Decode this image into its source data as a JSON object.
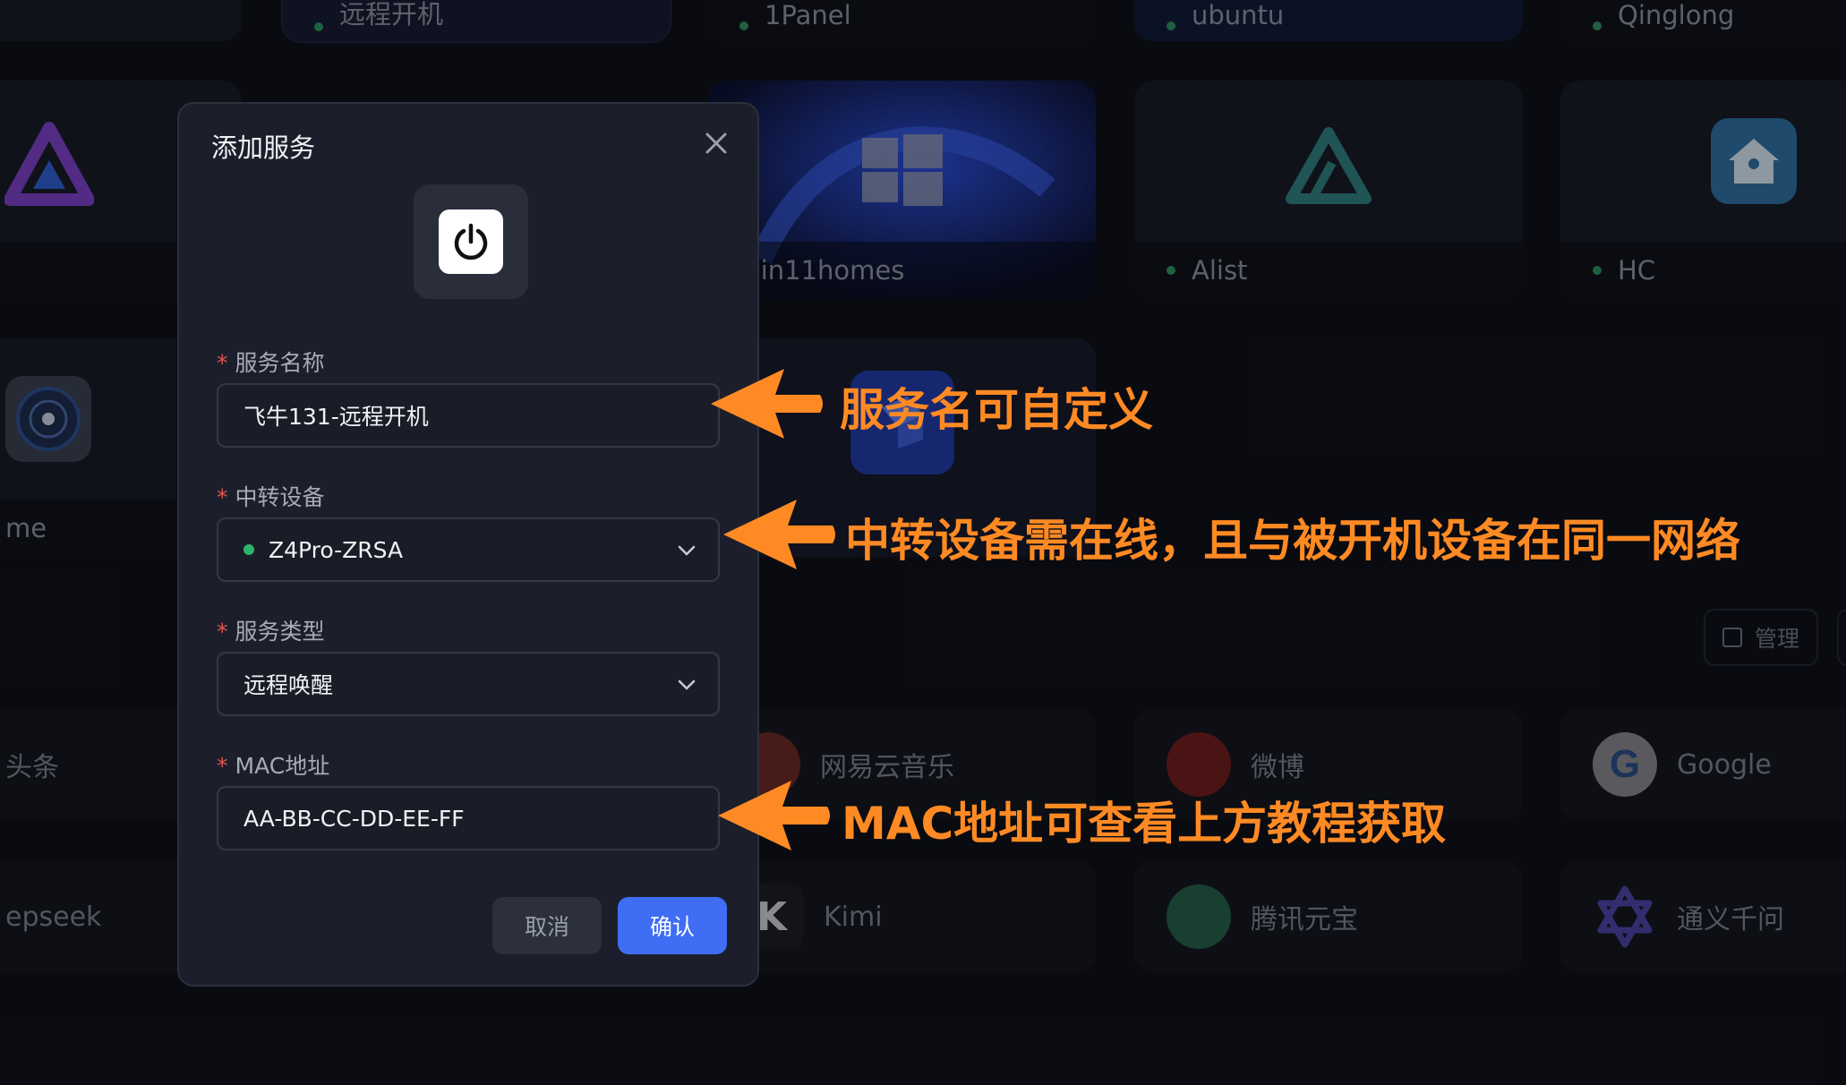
{
  "background": {
    "top_tiles": [
      {
        "label": ""
      },
      {
        "label": "远程开机"
      },
      {
        "label": "1Panel"
      },
      {
        "label": "ubuntu"
      },
      {
        "label": "Qinglong"
      }
    ],
    "apps_row1": [
      {
        "label": "",
        "icon": "jellyfin-icon"
      },
      {
        "label": "win11homes",
        "icon": "windows-icon"
      },
      {
        "label": "Alist",
        "icon": "alist-icon"
      },
      {
        "label": "HC",
        "icon": "home-assistant-icon"
      }
    ],
    "apps_row2": [
      {
        "label": "me",
        "icon": "music-disc-icon"
      },
      {
        "label": "",
        "icon": "blue-app-icon"
      }
    ],
    "manage_button": "管理",
    "links_row1": [
      {
        "label": "头条"
      },
      {
        "label": "网易云音乐"
      },
      {
        "label": "微博"
      },
      {
        "label": "Google"
      }
    ],
    "links_row2": [
      {
        "label": "epseek"
      },
      {
        "label": "Kimi"
      },
      {
        "label": "腾讯元宝"
      },
      {
        "label": "通义千问"
      }
    ]
  },
  "dialog": {
    "title": "添加服务",
    "required_mark": "*",
    "fields": {
      "service_name": {
        "label": "服务名称",
        "value": "飞牛131-远程开机"
      },
      "relay_device": {
        "label": "中转设备",
        "value": "Z4Pro-ZRSA",
        "status": "online"
      },
      "service_type": {
        "label": "服务类型",
        "value": "远程唤醒"
      },
      "mac_address": {
        "label": "MAC地址",
        "value": "AA-BB-CC-DD-EE-FF"
      }
    },
    "cancel_label": "取消",
    "confirm_label": "确认"
  },
  "annotations": {
    "name_hint": "服务名可自定义",
    "relay_hint": "中转设备需在线，且与被开机设备在同一网络",
    "mac_hint": "MAC地址可查看上方教程获取"
  },
  "colors": {
    "accent": "#3f6ef5",
    "annotation": "#ff8a24",
    "online": "#2fb36b",
    "required": "#e0564f"
  }
}
